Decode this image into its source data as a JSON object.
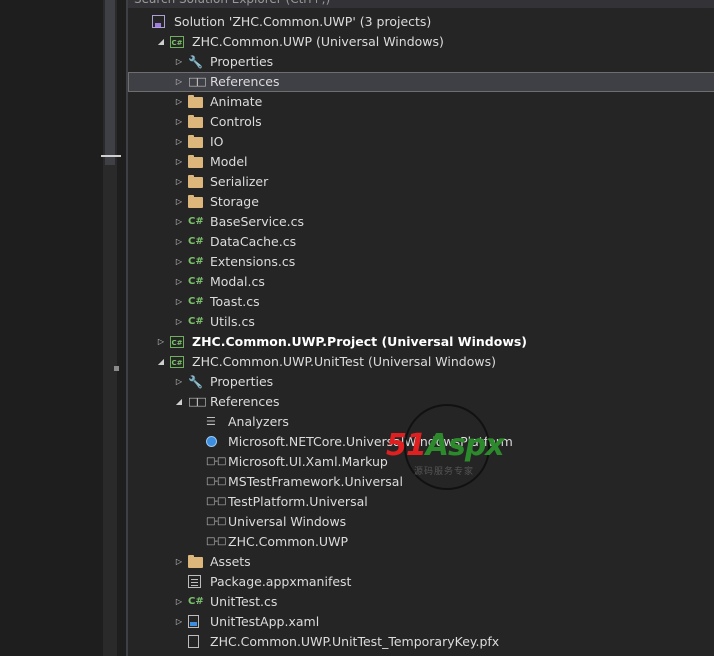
{
  "search": {
    "placeholder": "Search Solution Explorer (Ctrl+;)"
  },
  "colors": {
    "background": "#252526",
    "selection": "#3f3f46",
    "csharp": "#7cc26c",
    "folder": "#dcb67a"
  },
  "tree": [
    {
      "id": "solution",
      "label": "Solution 'ZHC.Common.UWP' (3 projects)",
      "icon": "solution-icon",
      "arrow": "",
      "depth": 0
    },
    {
      "id": "proj-common",
      "label": "ZHC.Common.UWP (Universal Windows)",
      "icon": "csharp-project-icon",
      "arrow": "expanded",
      "depth": 1
    },
    {
      "id": "properties-1",
      "label": "Properties",
      "icon": "wrench-icon",
      "arrow": "collapsed",
      "depth": 2
    },
    {
      "id": "references-1",
      "label": "References",
      "icon": "references-icon",
      "arrow": "collapsed",
      "depth": 2,
      "selected": true
    },
    {
      "id": "folder-animate",
      "label": "Animate",
      "icon": "folder-icon",
      "arrow": "collapsed",
      "depth": 2
    },
    {
      "id": "folder-controls",
      "label": "Controls",
      "icon": "folder-icon",
      "arrow": "collapsed",
      "depth": 2
    },
    {
      "id": "folder-io",
      "label": "IO",
      "icon": "folder-icon",
      "arrow": "collapsed",
      "depth": 2
    },
    {
      "id": "folder-model",
      "label": "Model",
      "icon": "folder-icon",
      "arrow": "collapsed",
      "depth": 2
    },
    {
      "id": "folder-serializer",
      "label": "Serializer",
      "icon": "folder-icon",
      "arrow": "collapsed",
      "depth": 2
    },
    {
      "id": "folder-storage",
      "label": "Storage",
      "icon": "folder-icon",
      "arrow": "collapsed",
      "depth": 2
    },
    {
      "id": "file-baseservice",
      "label": "BaseService.cs",
      "icon": "csharp-file-icon",
      "arrow": "collapsed",
      "depth": 2
    },
    {
      "id": "file-datacache",
      "label": "DataCache.cs",
      "icon": "csharp-file-icon",
      "arrow": "collapsed",
      "depth": 2
    },
    {
      "id": "file-extensions",
      "label": "Extensions.cs",
      "icon": "csharp-file-icon",
      "arrow": "collapsed",
      "depth": 2
    },
    {
      "id": "file-modal",
      "label": "Modal.cs",
      "icon": "csharp-file-icon",
      "arrow": "collapsed",
      "depth": 2
    },
    {
      "id": "file-toast",
      "label": "Toast.cs",
      "icon": "csharp-file-icon",
      "arrow": "collapsed",
      "depth": 2
    },
    {
      "id": "file-utils",
      "label": "Utils.cs",
      "icon": "csharp-file-icon",
      "arrow": "collapsed",
      "depth": 2
    },
    {
      "id": "proj-project",
      "label": "ZHC.Common.UWP.Project (Universal Windows)",
      "icon": "csharp-project-icon",
      "arrow": "collapsed",
      "depth": 1,
      "bold": true
    },
    {
      "id": "proj-unittest",
      "label": "ZHC.Common.UWP.UnitTest (Universal Windows)",
      "icon": "csharp-project-icon",
      "arrow": "expanded",
      "depth": 1
    },
    {
      "id": "properties-2",
      "label": "Properties",
      "icon": "wrench-icon",
      "arrow": "collapsed",
      "depth": 2
    },
    {
      "id": "references-2",
      "label": "References",
      "icon": "references-icon",
      "arrow": "expanded",
      "depth": 2
    },
    {
      "id": "ref-analyzers",
      "label": "Analyzers",
      "icon": "analyzer-icon",
      "arrow": "",
      "depth": 3
    },
    {
      "id": "ref-netcore",
      "label": "Microsoft.NETCore.UniversalWindowsPlatform",
      "icon": "netcore-icon",
      "arrow": "",
      "depth": 3
    },
    {
      "id": "ref-xamlmarkup",
      "label": "Microsoft.UI.Xaml.Markup",
      "icon": "reference-icon",
      "arrow": "",
      "depth": 3
    },
    {
      "id": "ref-mstest",
      "label": "MSTestFramework.Universal",
      "icon": "reference-icon",
      "arrow": "",
      "depth": 3
    },
    {
      "id": "ref-testplatform",
      "label": "TestPlatform.Universal",
      "icon": "reference-icon",
      "arrow": "",
      "depth": 3
    },
    {
      "id": "ref-uwp",
      "label": "Universal Windows",
      "icon": "reference-icon",
      "arrow": "",
      "depth": 3
    },
    {
      "id": "ref-zhc",
      "label": "ZHC.Common.UWP",
      "icon": "reference-icon",
      "arrow": "",
      "depth": 3
    },
    {
      "id": "folder-assets",
      "label": "Assets",
      "icon": "folder-icon",
      "arrow": "collapsed",
      "depth": 2
    },
    {
      "id": "file-manifest",
      "label": "Package.appxmanifest",
      "icon": "manifest-icon",
      "arrow": "",
      "depth": 2
    },
    {
      "id": "file-unittest",
      "label": "UnitTest.cs",
      "icon": "csharp-file-icon",
      "arrow": "collapsed",
      "depth": 2
    },
    {
      "id": "file-unittestapp",
      "label": "UnitTestApp.xaml",
      "icon": "xaml-icon",
      "arrow": "collapsed",
      "depth": 2
    },
    {
      "id": "file-pfx",
      "label": "ZHC.Common.UWP.UnitTest_TemporaryKey.pfx",
      "icon": "pfx-icon",
      "arrow": "",
      "depth": 2
    }
  ],
  "watermark": {
    "brand_red": "51",
    "brand_green": "Aspx",
    "subtitle": "源码服务专家"
  }
}
